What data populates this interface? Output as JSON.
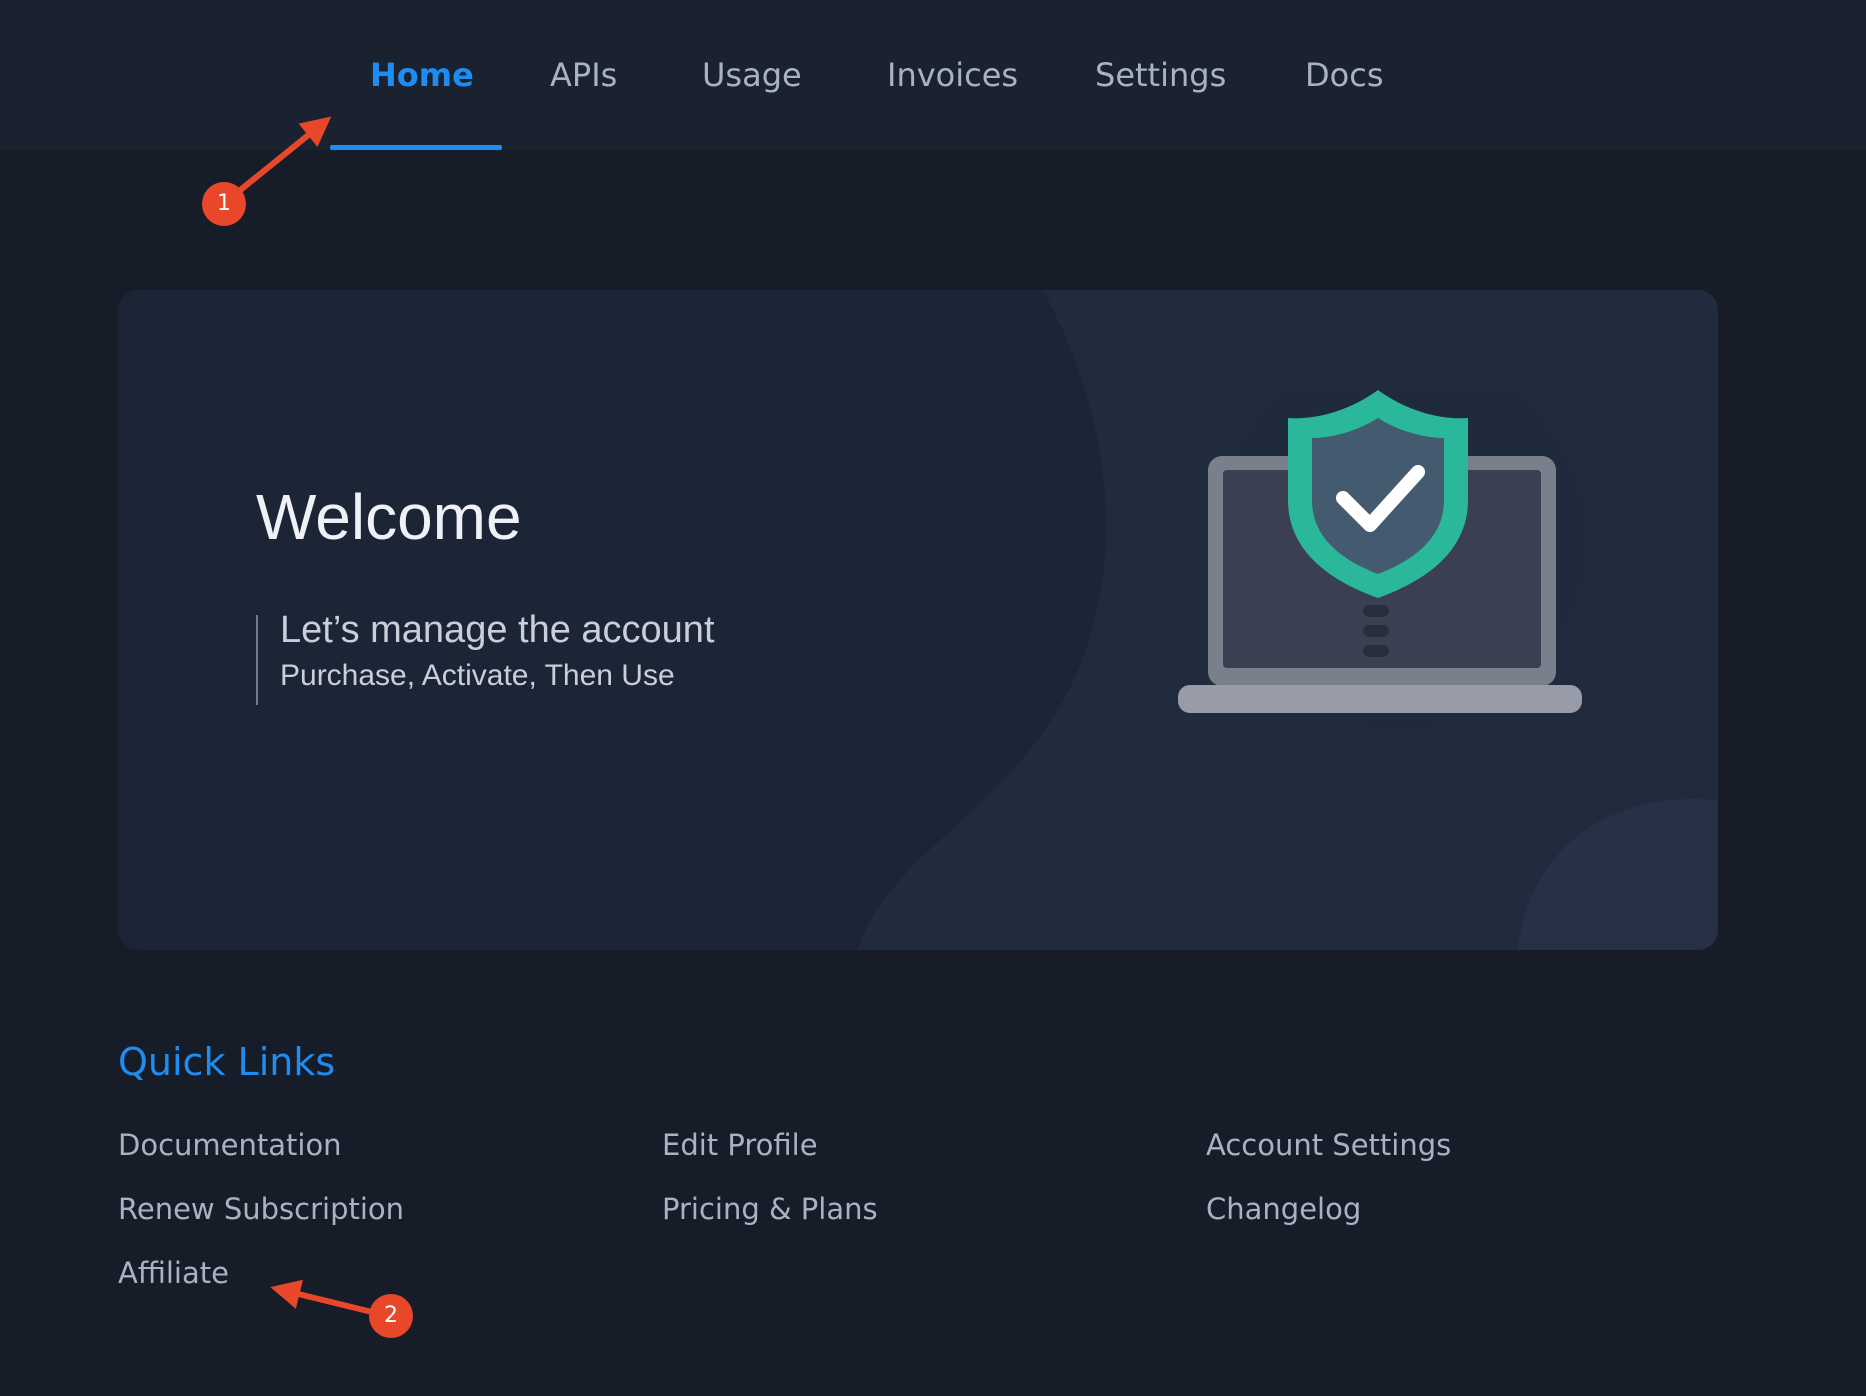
{
  "nav": {
    "tabs": [
      {
        "label": "Home",
        "active": true
      },
      {
        "label": "APIs"
      },
      {
        "label": "Usage"
      },
      {
        "label": "Invoices"
      },
      {
        "label": "Settings"
      },
      {
        "label": "Docs"
      }
    ]
  },
  "hero": {
    "title": "Welcome",
    "subtitle": "Let’s manage the account",
    "tagline": "Purchase, Activate, Then Use",
    "illustration": "laptop-shield-check-icon"
  },
  "quick_links": {
    "title": "Quick Links",
    "items": [
      "Documentation",
      "Edit Profile",
      "Account Settings",
      "Renew Subscription",
      "Pricing & Plans",
      "Changelog",
      "Affiliate"
    ]
  },
  "annotations": {
    "badge1": "1",
    "badge2": "2"
  },
  "colors": {
    "background": "#161d28",
    "nav_background": "#1a2230",
    "card": "#1c2536",
    "accent": "#1e8cf0",
    "text_muted": "#a8b2c2",
    "shield": "#2bb89a",
    "annotation": "#e8472a"
  }
}
